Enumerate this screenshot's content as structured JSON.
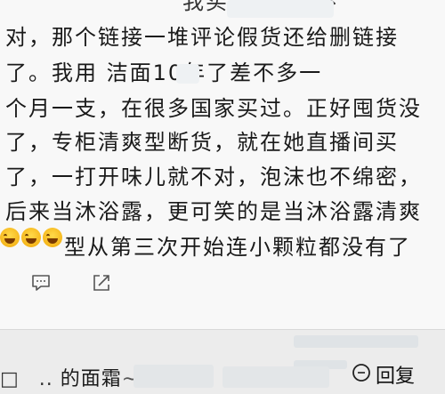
{
  "post": {
    "lines": [
      "对，那个链接一堆评论假货还给删链接",
      "了。我用 洁面10年了差不多一",
      "个月一支，在很多国家买过。正好囤货没",
      "了，专柜清爽型断货，就在她直播间买",
      "了，一打开味儿就不对，泡沫也不绵密，",
      "后来当沐浴露，更可笑的是当沐浴露清爽",
      "型从第三次开始连小颗粒都没有了"
    ],
    "top_fragment": "我买鞋 洁面 不",
    "emoji_count": 3
  },
  "actions": {
    "comment_icon": "comment-icon",
    "share_icon": "share-icon"
  },
  "bottom": {
    "left_text": "的面霜",
    "reply_label": "回复",
    "reply_icon": "reply-bubble-icon"
  }
}
